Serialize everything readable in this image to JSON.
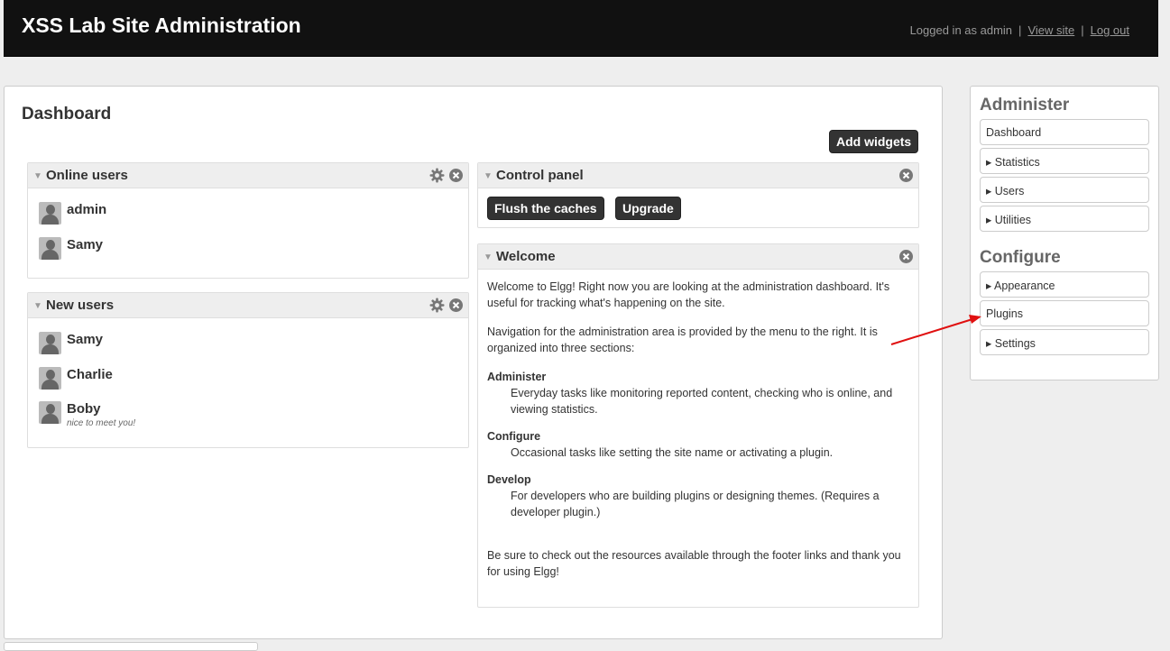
{
  "header": {
    "site_title": "XSS Lab Site Administration",
    "logged_in_text": "Logged in as admin",
    "separator": "|",
    "view_site": "View site",
    "log_out": "Log out"
  },
  "main": {
    "page_title": "Dashboard",
    "add_widgets": "Add widgets",
    "online_users": {
      "title": "Online users",
      "users": [
        {
          "name": "admin"
        },
        {
          "name": "Samy"
        }
      ]
    },
    "new_users": {
      "title": "New users",
      "users": [
        {
          "name": "Samy"
        },
        {
          "name": "Charlie"
        },
        {
          "name": "Boby",
          "subtitle": "nice to meet you!"
        }
      ]
    },
    "control_panel": {
      "title": "Control panel",
      "flush_caches": "Flush the caches",
      "upgrade": "Upgrade"
    },
    "welcome": {
      "title": "Welcome",
      "intro": "Welcome to Elgg! Right now you are looking at the administration dashboard. It's useful for tracking what's happening on the site.",
      "navigation": "Navigation for the administration area is provided by the menu to the right. It is organized into three sections:",
      "sections": [
        {
          "term": "Administer",
          "desc": "Everyday tasks like monitoring reported content, checking who is online, and viewing statistics."
        },
        {
          "term": "Configure",
          "desc": "Occasional tasks like setting the site name or activating a plugin."
        },
        {
          "term": "Develop",
          "desc": "For developers who are building plugins or designing themes. (Requires a developer plugin.)"
        }
      ],
      "outro": "Be sure to check out the resources available through the footer links and thank you for using Elgg!"
    }
  },
  "sidebar": {
    "administer_heading": "Administer",
    "administer_items": [
      "Dashboard",
      "▸ Statistics",
      "▸ Users",
      "▸ Utilities"
    ],
    "configure_heading": "Configure",
    "configure_items": [
      "▸ Appearance",
      "Plugins",
      "▸ Settings"
    ]
  },
  "colors": {
    "topbar": "#111111",
    "button": "#333333",
    "annotation_arrow": "#e01010"
  },
  "icons": {
    "collapse": "triangle-down-icon",
    "settings": "gear-icon",
    "close": "close-icon"
  }
}
